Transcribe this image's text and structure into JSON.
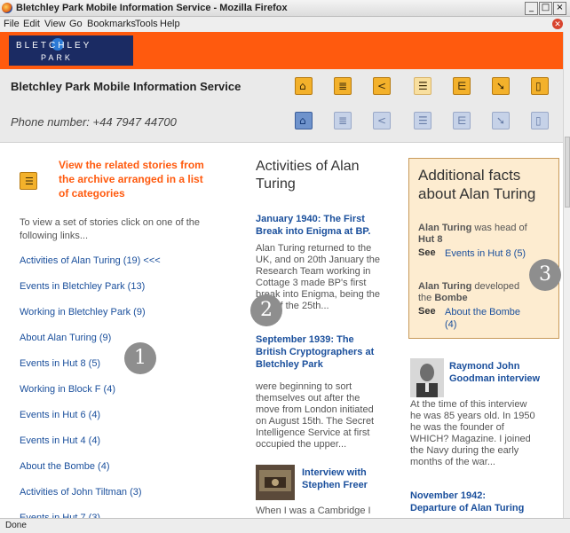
{
  "window": {
    "title": "Bletchley Park Mobile Information Service - Mozilla Firefox",
    "controls": [
      "_",
      "□",
      "×"
    ]
  },
  "menu": [
    "File",
    "Edit",
    "View",
    "Go",
    "Bookmarks",
    "Tools",
    "Help"
  ],
  "logo": {
    "line1": "BLETCHLEY",
    "line2": "PARK"
  },
  "header": {
    "site_title": "Bletchley Park Mobile Information Service",
    "phone": "Phone number: +44 7947 44700",
    "icons_row1": [
      "home-icon",
      "list-icon",
      "share-icon",
      "categories-icon",
      "tree-icon",
      "pointer-icon",
      "phone-icon"
    ],
    "icons_row2": [
      "home-icon",
      "list-icon",
      "share-icon",
      "categories-icon",
      "tree-icon",
      "pointer-icon",
      "phone-icon"
    ]
  },
  "left": {
    "archive_heading": "View the archive arranged in a list of categories",
    "archive_heading_lines": [
      "View the related stories from",
      "the archive arranged in a list",
      "of categories"
    ],
    "intro_lines": [
      "To view a set of stories click on one of the",
      "following links..."
    ],
    "categories": [
      "Activities of Alan Turing (19) <<<",
      "Events in Bletchley Park (13)",
      "Working in Bletchley Park (9)",
      "About Alan Turing (9)",
      "Events in Hut 8 (5)",
      "Working in Block F (4)",
      "Events in Hut 6 (4)",
      "Events in Hut 4 (4)",
      "About the Bombe (4)",
      "Activities of John Tiltman (3)",
      "Events in Hut 7 (3)"
    ]
  },
  "middle": {
    "title_lines": [
      "Activities of Alan",
      "Turing"
    ],
    "stories": [
      {
        "title_lines": [
          "January 1940: The First",
          "Break into Enigma at BP."
        ],
        "body_lines": [
          "Alan Turing returned to the",
          "UK, and on 20th January the",
          "Research Team working in",
          "Cottage 3 made BP's first",
          "break into Enigma, being the",
          "...th of the 25th..."
        ]
      },
      {
        "title_lines": [
          "September 1939: The",
          "British Cryptographers at",
          "Bletchley Park"
        ],
        "body_lines": [
          "were beginning to sort",
          "themselves out after the",
          "move from London initiated",
          "on August 15th. The Secret",
          "Intelligence Service at first",
          "occupied the upper..."
        ]
      },
      {
        "title_lines": [
          "Interview with",
          "Stephen Freer"
        ],
        "body_lines": [
          "When I was a Cambridge I"
        ]
      }
    ]
  },
  "right": {
    "facts_title_lines": [
      "Additional facts",
      "about Alan Turing"
    ],
    "facts": [
      {
        "subject": "Alan Turing",
        "text": " was head of",
        "object": "Hut 8",
        "see_label": "See",
        "link_lines": [
          "Events in Hut 8 (5)"
        ]
      },
      {
        "subject": "Alan Turing",
        "text": " developed",
        "prefix": "the ",
        "object": "Bombe",
        "see_label": "See",
        "link_lines": [
          "About the Bombe",
          "(4)"
        ]
      }
    ],
    "story1": {
      "title_lines": [
        "Raymond John",
        "Goodman interview"
      ],
      "body_lines": [
        "At the time of this interview",
        "he was 85 years old. In 1950",
        "he was the founder of",
        "WHICH? Magazine. I joined",
        "the Navy during the early",
        "months of the war..."
      ]
    },
    "story2": {
      "title_lines": [
        "November 1942:",
        "Departure of Alan Turing"
      ]
    }
  },
  "markers": [
    "1",
    "2",
    "3"
  ],
  "status": "Done"
}
